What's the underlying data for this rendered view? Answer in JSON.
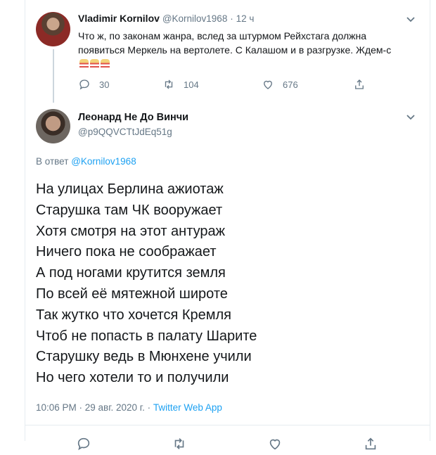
{
  "parent": {
    "name": "Vladimir Kornilov",
    "handle": "@Kornilov1968",
    "dot": "·",
    "time": "12 ч",
    "text": "Что ж, по законам жанра, вслед за штурмом Рейхстага должна появиться Меркель на вертолете. С Калашом и в разгрузке. Ждем-с",
    "actions": {
      "replies": "30",
      "retweets": "104",
      "likes": "676"
    },
    "icons": [
      "reply-icon",
      "retweet-icon",
      "like-icon",
      "share-icon",
      "popcorn-icon"
    ]
  },
  "reply": {
    "name": "Леонард Не До Винчи",
    "handle": "@p9QQVCTtJdEq51g",
    "replying_prefix": "В ответ",
    "replying_to": "@Kornilov1968",
    "lines": [
      "На улицах Берлина ажиотаж",
      "Старушка там ЧК вооружает",
      "Хотя смотря на этот антураж",
      "Ничего пока не соображает",
      "А под ногами крутится земля",
      "По всей её мятежной широте",
      "Так жутко что хочется Кремля",
      "Чтоб не попасть в палату Шарите",
      "Старушку ведь в Мюнхене учили",
      "Но чего хотели то и получили"
    ],
    "meta_time": "10:06 PM · 29 авг. 2020 г. · ",
    "meta_app": "Twitter Web App"
  },
  "colors": {
    "link": "#1da1f2",
    "muted": "#657786",
    "text": "#14171a"
  }
}
